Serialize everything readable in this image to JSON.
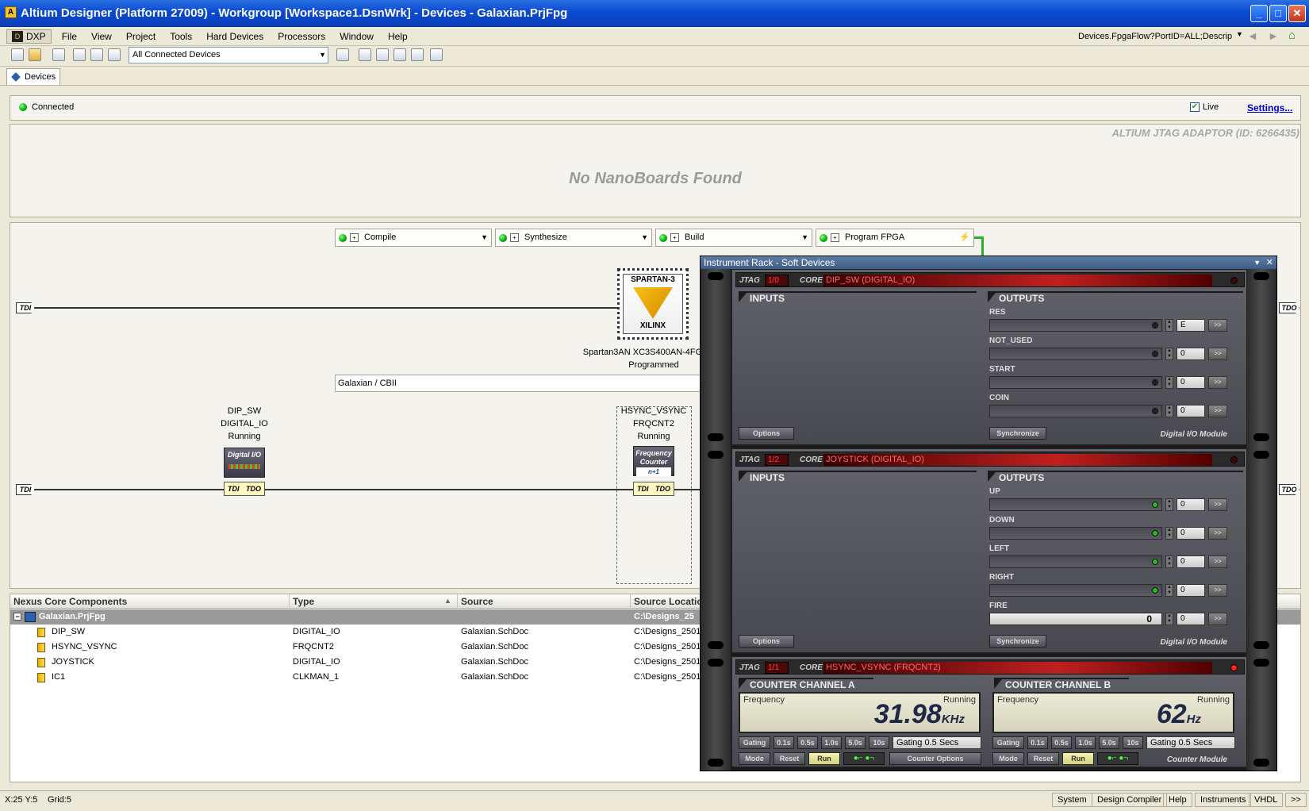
{
  "window": {
    "title": "Altium Designer (Platform 27009) - Workgroup [Workspace1.DsnWrk] - Devices - Galaxian.PrjFpg"
  },
  "menu": {
    "dxp": "DXP",
    "items": [
      "File",
      "View",
      "Project",
      "Tools",
      "Hard Devices",
      "Processors",
      "Window",
      "Help"
    ]
  },
  "nav": {
    "url": "Devices.FpgaFlow?PortID=ALL;Descrip"
  },
  "toolbar": {
    "device_filter": "All Connected Devices"
  },
  "tabs": {
    "devices": "Devices"
  },
  "connection": {
    "status": "Connected",
    "live_label": "Live",
    "live_checked": true,
    "settings": "Settings..."
  },
  "nanoboard": {
    "adaptor": "ALTIUM JTAG ADAPTOR (ID: 6266435)",
    "message": "No NanoBoards Found"
  },
  "flow": {
    "compile": "Compile",
    "synthesize": "Synthesize",
    "build": "Build",
    "program": "Program FPGA"
  },
  "chain": {
    "tdi": "TDI",
    "tdo": "TDO",
    "chip_brand": "SPARTAN-3",
    "chip_maker": "XILINX",
    "chip_name": "Spartan3AN XC3S400AN-4FG",
    "chip_status": "Programmed",
    "project_box": "Galaxian / CBII",
    "dip": {
      "name": "DIP_SW",
      "type": "DIGITAL_IO",
      "status": "Running",
      "icon_label": "Digital I/O"
    },
    "hsync": {
      "name": "HSYNC_VSYNC",
      "type": "FRQCNT2",
      "status": "Running",
      "icon_label": "Frequency Counter",
      "icon_sub": "n+1"
    },
    "pin_tdi": "TDI",
    "pin_tdo": "TDO"
  },
  "table": {
    "headers": [
      "Nexus Core Components",
      "Type",
      "Source",
      "Source Location"
    ],
    "rows": [
      {
        "name": "Galaxian.PrjFpg",
        "type": "",
        "source": "",
        "location": "C:\\Designs_25"
      },
      {
        "name": "DIP_SW",
        "type": "DIGITAL_IO",
        "source": "Galaxian.SchDoc",
        "location": "C:\\Designs_2501"
      },
      {
        "name": "HSYNC_VSYNC",
        "type": "FRQCNT2",
        "source": "Galaxian.SchDoc",
        "location": "C:\\Designs_2501"
      },
      {
        "name": "JOYSTICK",
        "type": "DIGITAL_IO",
        "source": "Galaxian.SchDoc",
        "location": "C:\\Designs_2501"
      },
      {
        "name": "IC1",
        "type": "CLKMAN_1",
        "source": "Galaxian.SchDoc",
        "location": "C:\\Designs_2501"
      }
    ]
  },
  "rack": {
    "title": "Instrument Rack - Soft Devices",
    "jtag": "JTAG",
    "core": "CORE",
    "inputs": "INPUTS",
    "outputs": "OUTPUTS",
    "options": "Options",
    "synchronize": "Synchronize",
    "dio_module": "Digital I/O Module",
    "inst1": {
      "jtag": "1/0",
      "core": "DIP_SW (DIGITAL_IO)",
      "outputs": [
        {
          "label": "RES",
          "value": "E"
        },
        {
          "label": "NOT_USED",
          "value": "0"
        },
        {
          "label": "START",
          "value": "0"
        },
        {
          "label": "COIN",
          "value": "0"
        }
      ]
    },
    "inst2": {
      "jtag": "1/2",
      "core": "JOYSTICK (DIGITAL_IO)",
      "outputs": [
        {
          "label": "UP",
          "value": "0"
        },
        {
          "label": "DOWN",
          "value": "0"
        },
        {
          "label": "LEFT",
          "value": "0"
        },
        {
          "label": "RIGHT",
          "value": "0"
        },
        {
          "label": "FIRE",
          "value": "0",
          "bar_value": "0"
        }
      ]
    },
    "inst3": {
      "jtag": "1/1",
      "core": "HSYNC_VSYNC (FRQCNT2)",
      "channel_a": "COUNTER CHANNEL A",
      "channel_b": "COUNTER CHANNEL B",
      "freq_label": "Frequency",
      "running": "Running",
      "a_value": "31.98",
      "a_unit": "KHz",
      "b_value": "62",
      "b_unit": "Hz",
      "gating": "Gating",
      "gate_opts": [
        "0.1s",
        "0.5s",
        "1.0s",
        "5.0s",
        "10s"
      ],
      "gating_value": "Gating  0.5 Secs",
      "mode": "Mode",
      "reset": "Reset",
      "run": "Run",
      "counter_options": "Counter Options",
      "counter_module": "Counter Module"
    }
  },
  "status": {
    "coords": "X:25 Y:5",
    "grid": "Grid:5",
    "panels": [
      "System",
      "Design Compiler",
      "Help",
      "Instruments",
      "VHDL"
    ]
  }
}
